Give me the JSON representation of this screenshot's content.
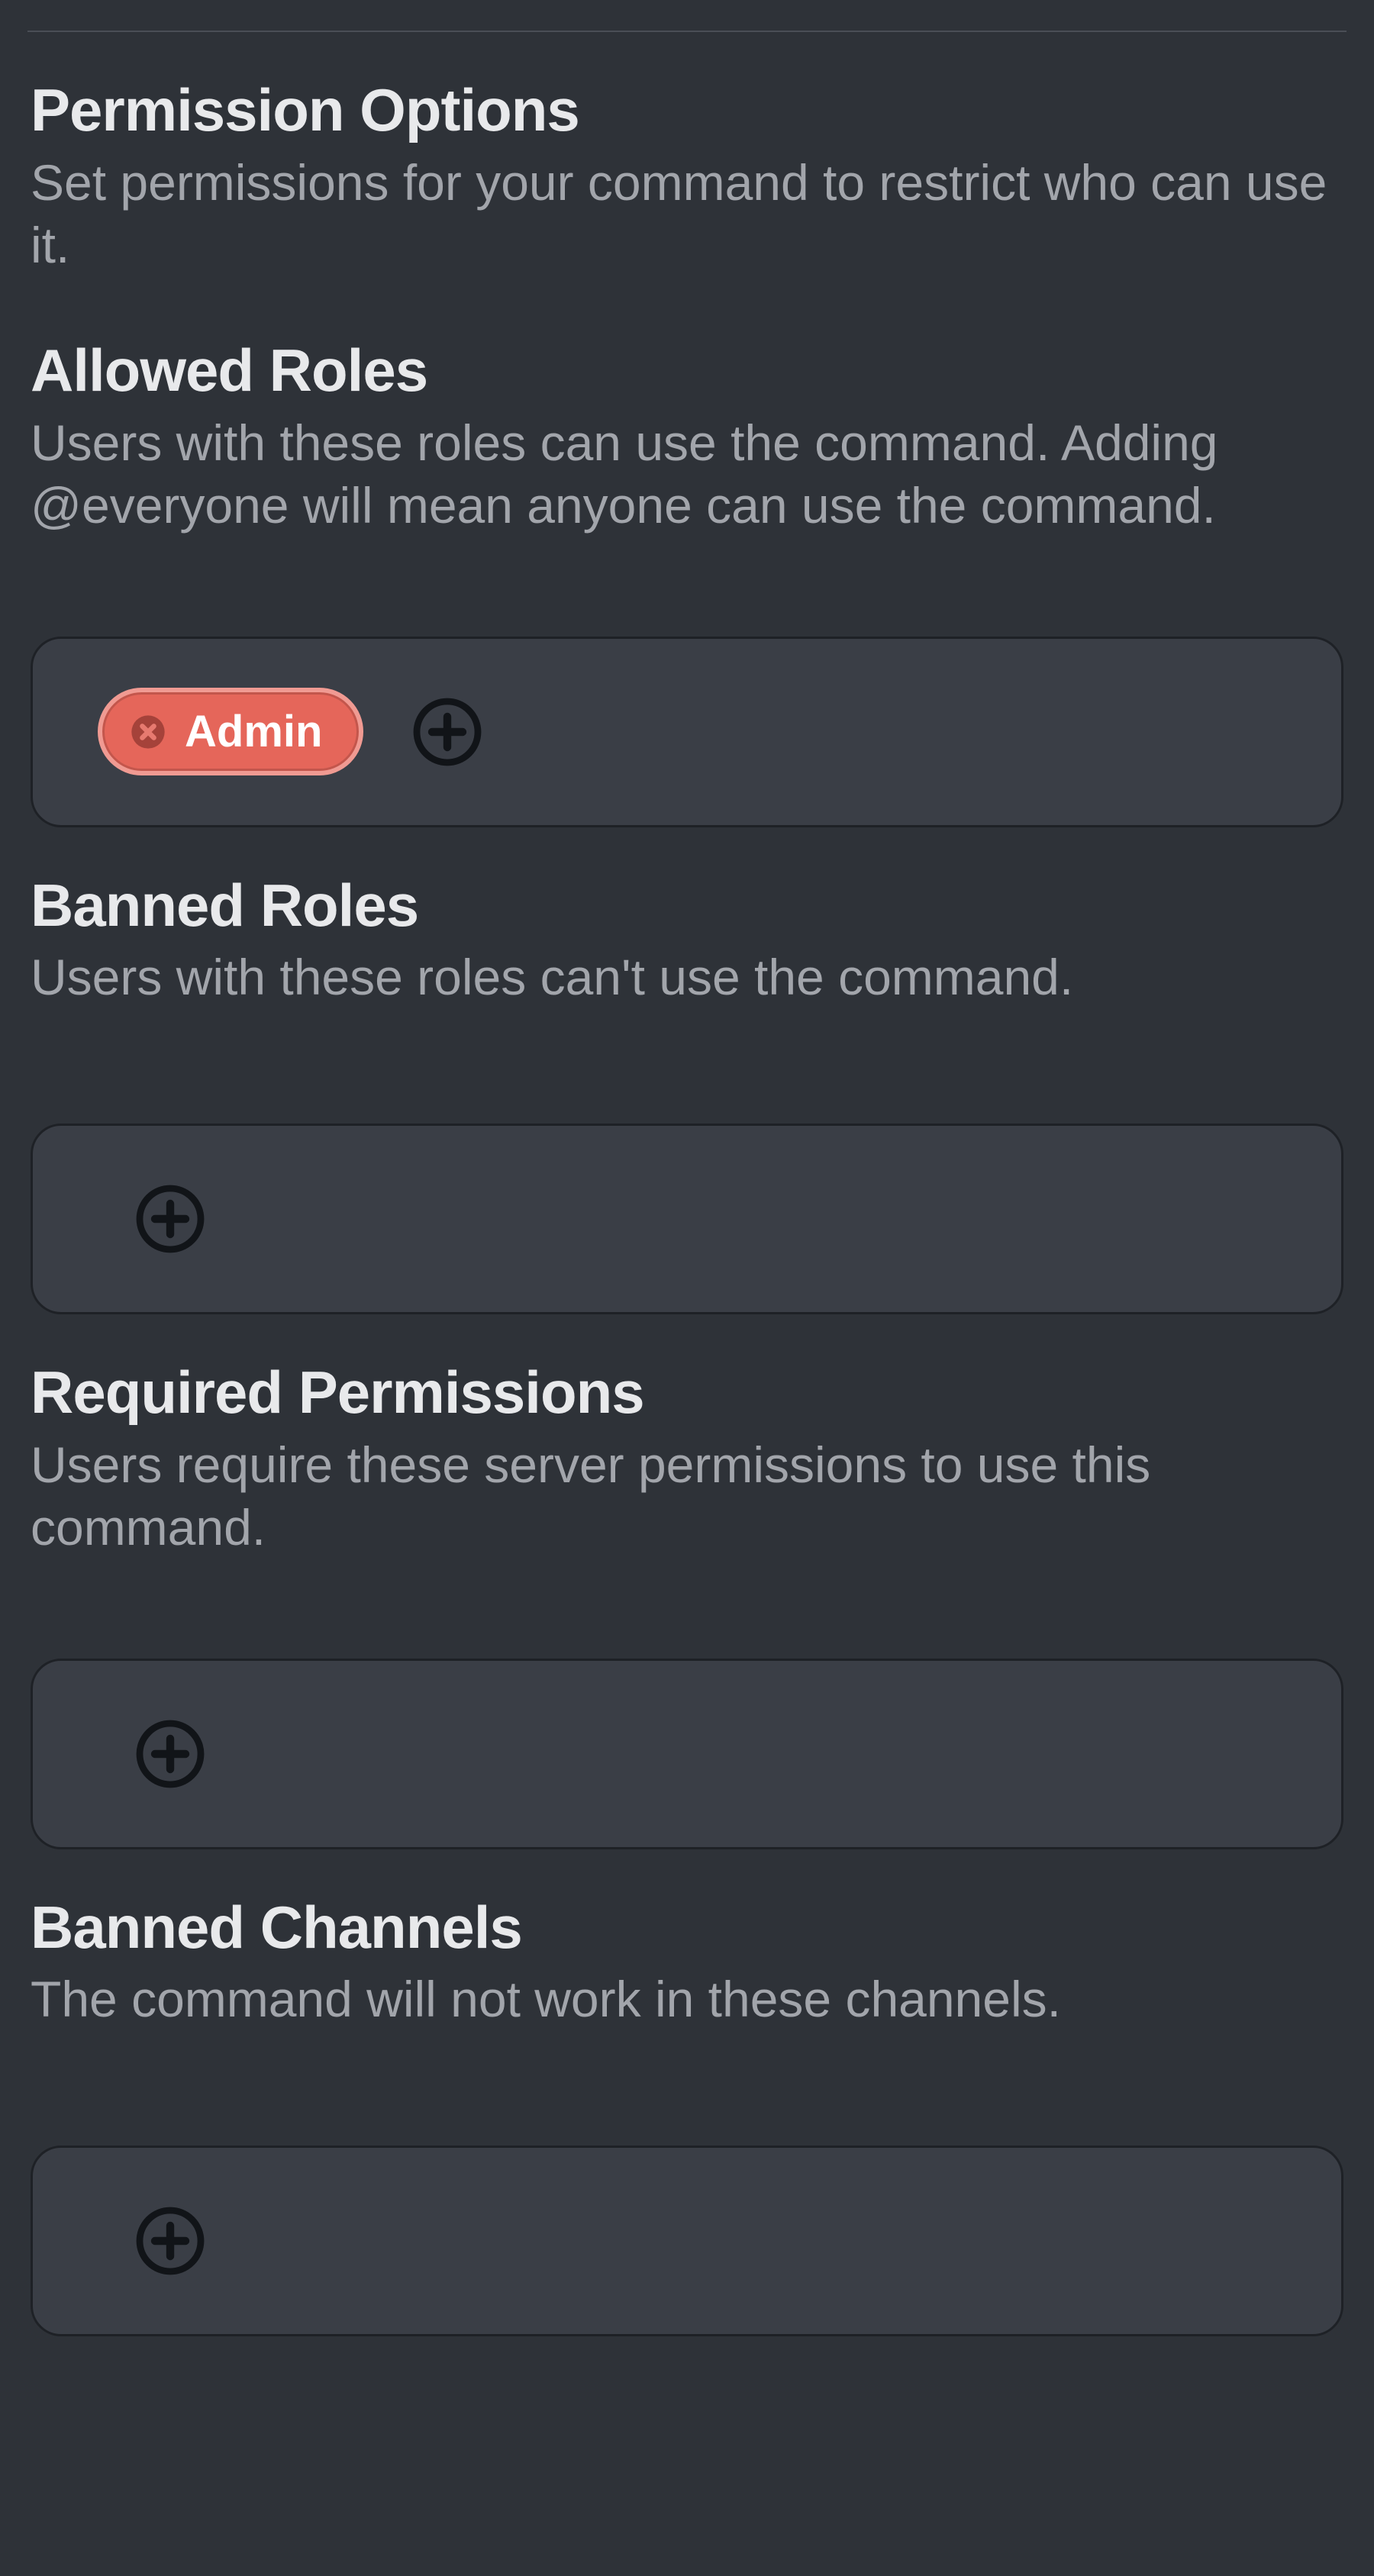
{
  "colors": {
    "background": "#2e3238",
    "panel": "#3a3e46",
    "border": "#1e2126",
    "text": "#e8e9eb",
    "muted": "#a2a5ab",
    "chip_bg": "#e5665a",
    "chip_border": "#f09a92",
    "icon_dark": "#111418",
    "icon_x": "#9c3a31"
  },
  "icons": {
    "plus": "plus-circle-icon",
    "remove": "x-circle-icon"
  },
  "permission_options": {
    "title": "Permission Options",
    "desc": "Set permissions for your command to restrict who can use it."
  },
  "allowed_roles": {
    "title": "Allowed Roles",
    "desc": "Users with these roles can use the command. Adding @everyone will mean anyone can use the command.",
    "chips": [
      {
        "label": "Admin"
      }
    ]
  },
  "banned_roles": {
    "title": "Banned Roles",
    "desc": "Users with these roles can't use the command.",
    "chips": []
  },
  "required_permissions": {
    "title": "Required Permissions",
    "desc": "Users require these server permissions to use this command.",
    "chips": []
  },
  "banned_channels": {
    "title": "Banned Channels",
    "desc": "The command will not work in these channels.",
    "chips": []
  }
}
